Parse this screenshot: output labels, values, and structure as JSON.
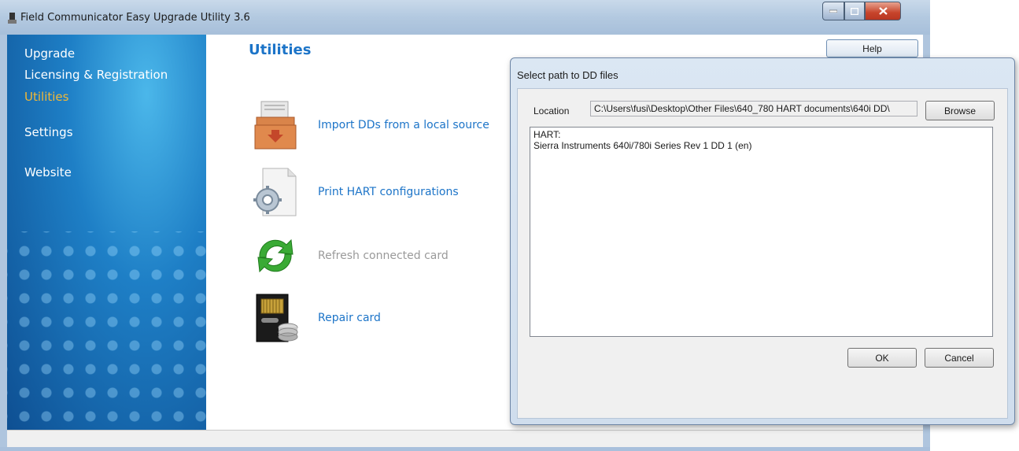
{
  "window": {
    "title": "Field Communicator Easy Upgrade Utility 3.6"
  },
  "sidebar": {
    "items": [
      {
        "label": "Upgrade",
        "active": false
      },
      {
        "label": "Licensing & Registration",
        "active": false
      },
      {
        "label": "Utilities",
        "active": true
      },
      {
        "label": "Settings",
        "active": false
      },
      {
        "label": "Website",
        "active": false
      }
    ]
  },
  "main": {
    "page_title": "Utilities",
    "help_label": "Help",
    "utilities": [
      {
        "label": "Import DDs from a local source",
        "icon": "import-box-icon",
        "enabled": true
      },
      {
        "label": "Print HART configurations",
        "icon": "gear-document-icon",
        "enabled": true
      },
      {
        "label": "Refresh connected card",
        "icon": "refresh-arrows-icon",
        "enabled": false
      },
      {
        "label": "Repair card",
        "icon": "memory-card-repair-icon",
        "enabled": true
      }
    ]
  },
  "dialog": {
    "title": "Select path to DD files",
    "location_label": "Location",
    "location_value": "C:\\Users\\fusi\\Desktop\\Other Files\\640_780 HART documents\\640i DD\\",
    "browse_label": "Browse",
    "list_lines": [
      "HART:",
      "Sierra Instruments 640i/780i Series Rev 1 DD 1 (en)"
    ],
    "ok_label": "OK",
    "cancel_label": "Cancel"
  },
  "colors": {
    "accent_blue": "#1c74c8",
    "active_nav": "#f2b836",
    "disabled_text": "#9a9a9a"
  }
}
